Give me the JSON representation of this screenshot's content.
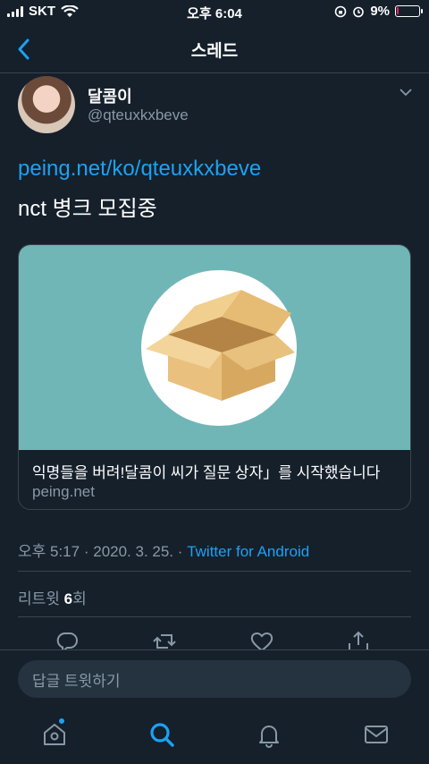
{
  "status_bar": {
    "carrier": "SKT",
    "time": "오후 6:04",
    "battery": "9%",
    "battery_level": 0.09
  },
  "nav": {
    "title": "스레드"
  },
  "tweet": {
    "display_name": "달콤이",
    "handle": "@qteuxkxbeve",
    "link": "peing.net/ko/qteuxkxbeve",
    "text": "nct 병크 모집중",
    "card": {
      "title": "익명들을 버려!달콤이 씨가 질문 상자」를 시작했습니다",
      "domain": "peing.net"
    },
    "meta": {
      "time": "오후 5:17",
      "date": "2020. 3. 25.",
      "separator": "·",
      "source": "Twitter for Android"
    },
    "retweets": {
      "prefix": "리트윗 ",
      "count": "6",
      "suffix": "회"
    }
  },
  "reply": {
    "placeholder": "답글 트윗하기"
  },
  "colors": {
    "background": "#15202b",
    "accent": "#1da1f2",
    "muted": "#8899a6",
    "divider": "#38444d",
    "card_image_bg": "#71b6b6"
  }
}
